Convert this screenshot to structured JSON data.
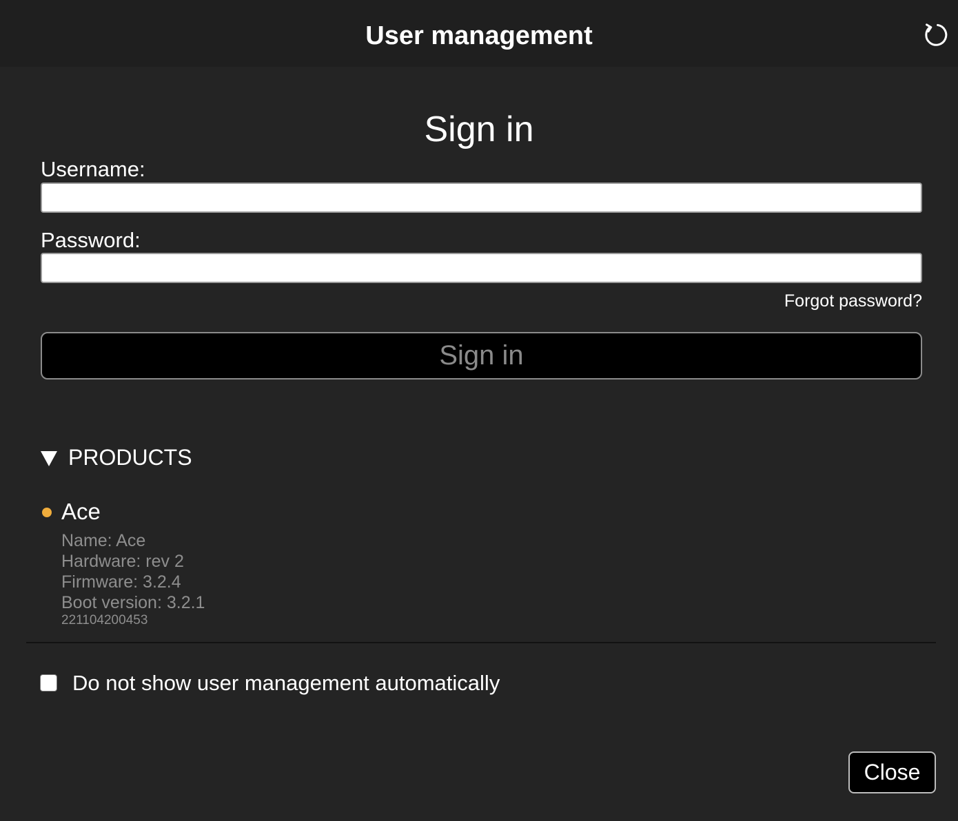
{
  "header": {
    "title": "User management",
    "refresh_icon": "refresh-icon"
  },
  "signin": {
    "title": "Sign in",
    "username_label": "Username:",
    "username_value": "",
    "password_label": "Password:",
    "password_value": "",
    "forgot_password": "Forgot password?",
    "button_label": "Sign in"
  },
  "products": {
    "toggle_label": "PRODUCTS",
    "expanded": true,
    "items": [
      {
        "name": "Ace",
        "status_color": "#f0ad3c",
        "details": [
          "Name: Ace",
          "Hardware: rev 2",
          "Firmware: 3.2.4",
          "Boot version: 3.2.1"
        ],
        "serial": "221104200453"
      }
    ]
  },
  "options": {
    "dont_show_label": "Do not show user management automatically",
    "dont_show_checked": false
  },
  "footer": {
    "close_label": "Close"
  }
}
